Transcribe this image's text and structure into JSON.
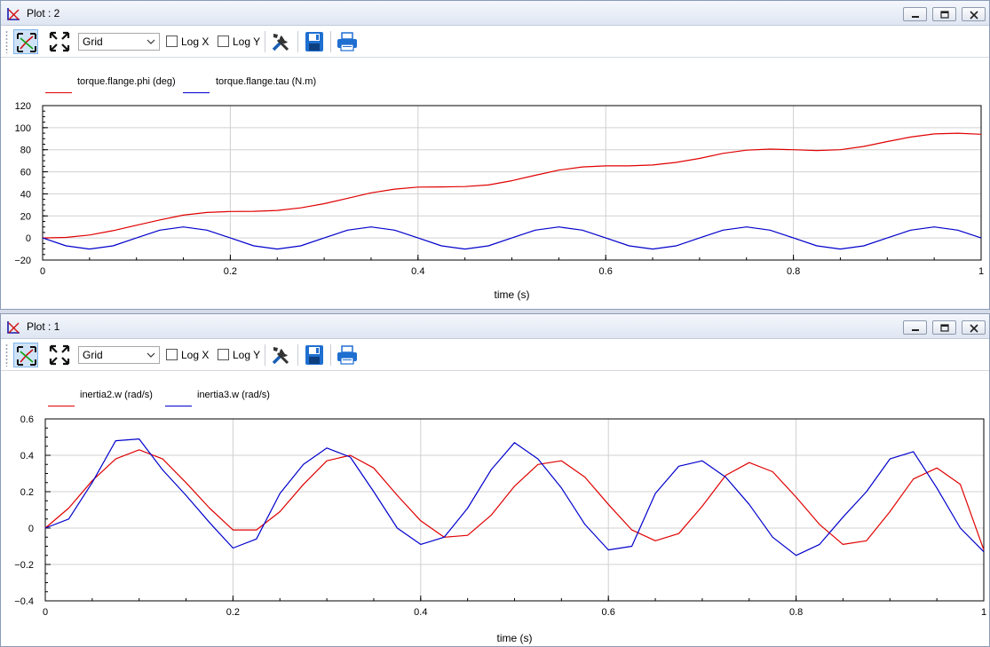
{
  "windows": [
    {
      "title": "Plot : 2",
      "toolbar": {
        "grid_value": "Grid",
        "log_x_label": "Log X",
        "log_y_label": "Log Y",
        "log_x_checked": false,
        "log_y_checked": false
      },
      "legend": [
        {
          "label": "torque.flange.phi (deg)",
          "color": "#e00000"
        },
        {
          "label": "torque.flange.tau (N.m)",
          "color": "#0000cc"
        }
      ],
      "chart_data": {
        "type": "line",
        "xlabel": "time (s)",
        "ylabel": "",
        "xlim": [
          0,
          1
        ],
        "ylim": [
          -20,
          120
        ],
        "xticks": [
          0,
          0.2,
          0.4,
          0.6,
          0.8,
          1
        ],
        "yticks": [
          -20,
          0,
          20,
          40,
          60,
          80,
          100,
          120
        ],
        "xtick_labels": [
          "0",
          "0.2",
          "0.4",
          "0.6",
          "0.8",
          "1"
        ],
        "ytick_labels": [
          "−20",
          "0",
          "20",
          "40",
          "60",
          "80",
          "100",
          "120"
        ],
        "grid": true,
        "series": [
          {
            "name": "torque.flange.phi (deg)",
            "color": "#e00000",
            "x": [
              0,
              0.025,
              0.05,
              0.075,
              0.1,
              0.125,
              0.15,
              0.175,
              0.2,
              0.225,
              0.25,
              0.275,
              0.3,
              0.325,
              0.35,
              0.375,
              0.4,
              0.425,
              0.45,
              0.475,
              0.5,
              0.525,
              0.55,
              0.575,
              0.6,
              0.625,
              0.65,
              0.675,
              0.7,
              0.725,
              0.75,
              0.775,
              0.8,
              0.825,
              0.85,
              0.875,
              0.9,
              0.925,
              0.95,
              0.975,
              1.0
            ],
            "y": [
              0,
              0.5,
              2.7,
              6.6,
              11.5,
              16.4,
              20.7,
              23.1,
              24.0,
              24.2,
              25.0,
              27.3,
              31.1,
              36.0,
              40.9,
              44.3,
              46.1,
              46.3,
              46.6,
              48.1,
              51.9,
              56.8,
              61.5,
              64.4,
              65.4,
              65.4,
              66.2,
              68.5,
              72.1,
              76.7,
              79.6,
              80.6,
              80.0,
              79.3,
              80.0,
              83.0,
              87.4,
              91.5,
              94.3,
              95.0,
              94.0
            ]
          },
          {
            "name": "torque.flange.tau (N.m)",
            "color": "#0000cc",
            "x": [
              0,
              0.025,
              0.05,
              0.075,
              0.1,
              0.125,
              0.15,
              0.175,
              0.2,
              0.225,
              0.25,
              0.275,
              0.3,
              0.325,
              0.35,
              0.375,
              0.4,
              0.425,
              0.45,
              0.475,
              0.5,
              0.525,
              0.55,
              0.575,
              0.6,
              0.625,
              0.65,
              0.675,
              0.7,
              0.725,
              0.75,
              0.775,
              0.8,
              0.825,
              0.85,
              0.875,
              0.9,
              0.925,
              0.95,
              0.975,
              1.0
            ],
            "y": [
              0,
              -7.1,
              -10,
              -7.1,
              0,
              7.1,
              10,
              7.1,
              0,
              -7.1,
              -10,
              -7.1,
              0,
              7.1,
              10,
              7.1,
              0,
              -7.1,
              -10,
              -7.1,
              0,
              7.1,
              10,
              7.1,
              0,
              -7.1,
              -10,
              -7.1,
              0,
              7.1,
              10,
              7.1,
              0,
              -7.1,
              -10,
              -7.1,
              0,
              7.1,
              10,
              7.1,
              0
            ]
          }
        ]
      }
    },
    {
      "title": "Plot : 1",
      "toolbar": {
        "grid_value": "Grid",
        "log_x_label": "Log X",
        "log_y_label": "Log Y",
        "log_x_checked": false,
        "log_y_checked": false
      },
      "legend": [
        {
          "label": "inertia2.w (rad/s)",
          "color": "#e00000"
        },
        {
          "label": "inertia3.w (rad/s)",
          "color": "#0000cc"
        }
      ],
      "chart_data": {
        "type": "line",
        "xlabel": "time (s)",
        "ylabel": "",
        "xlim": [
          0,
          1
        ],
        "ylim": [
          -0.4,
          0.6
        ],
        "xticks": [
          0,
          0.2,
          0.4,
          0.6,
          0.8,
          1
        ],
        "yticks": [
          -0.4,
          -0.2,
          0,
          0.2,
          0.4,
          0.6
        ],
        "xtick_labels": [
          "0",
          "0.2",
          "0.4",
          "0.6",
          "0.8",
          "1"
        ],
        "ytick_labels": [
          "−0.4",
          "−0.2",
          "0",
          "0.2",
          "0.4",
          "0.6"
        ],
        "grid": true,
        "series": [
          {
            "name": "inertia2.w (rad/s)",
            "color": "#e00000",
            "x": [
              0,
              0.025,
              0.05,
              0.075,
              0.1,
              0.125,
              0.15,
              0.175,
              0.2,
              0.225,
              0.25,
              0.275,
              0.3,
              0.325,
              0.35,
              0.375,
              0.4,
              0.425,
              0.45,
              0.475,
              0.5,
              0.525,
              0.55,
              0.575,
              0.6,
              0.625,
              0.65,
              0.675,
              0.7,
              0.725,
              0.75,
              0.775,
              0.8,
              0.825,
              0.85,
              0.875,
              0.9,
              0.925,
              0.95,
              0.975,
              1.0
            ],
            "y": [
              0,
              0.11,
              0.26,
              0.38,
              0.43,
              0.38,
              0.25,
              0.11,
              -0.01,
              -0.01,
              0.09,
              0.24,
              0.37,
              0.4,
              0.33,
              0.18,
              0.04,
              -0.05,
              -0.04,
              0.07,
              0.23,
              0.35,
              0.37,
              0.28,
              0.13,
              -0.01,
              -0.07,
              -0.03,
              0.12,
              0.29,
              0.36,
              0.31,
              0.17,
              0.02,
              -0.09,
              -0.07,
              0.09,
              0.27,
              0.33,
              0.24,
              -0.12
            ]
          },
          {
            "name": "inertia3.w (rad/s)",
            "color": "#0000cc",
            "x": [
              0,
              0.025,
              0.05,
              0.075,
              0.1,
              0.125,
              0.15,
              0.175,
              0.2,
              0.225,
              0.25,
              0.275,
              0.3,
              0.325,
              0.35,
              0.375,
              0.4,
              0.425,
              0.45,
              0.475,
              0.5,
              0.525,
              0.55,
              0.575,
              0.6,
              0.625,
              0.65,
              0.675,
              0.7,
              0.725,
              0.75,
              0.775,
              0.8,
              0.825,
              0.85,
              0.875,
              0.9,
              0.925,
              0.95,
              0.975,
              1.0
            ],
            "y": [
              0,
              0.05,
              0.25,
              0.48,
              0.49,
              0.32,
              0.18,
              0.03,
              -0.11,
              -0.06,
              0.19,
              0.35,
              0.44,
              0.39,
              0.2,
              0.0,
              -0.09,
              -0.05,
              0.11,
              0.32,
              0.47,
              0.38,
              0.22,
              0.02,
              -0.12,
              -0.1,
              0.19,
              0.34,
              0.37,
              0.28,
              0.13,
              -0.05,
              -0.15,
              -0.09,
              0.06,
              0.2,
              0.38,
              0.42,
              0.22,
              0.0,
              -0.13
            ]
          }
        ]
      }
    }
  ]
}
